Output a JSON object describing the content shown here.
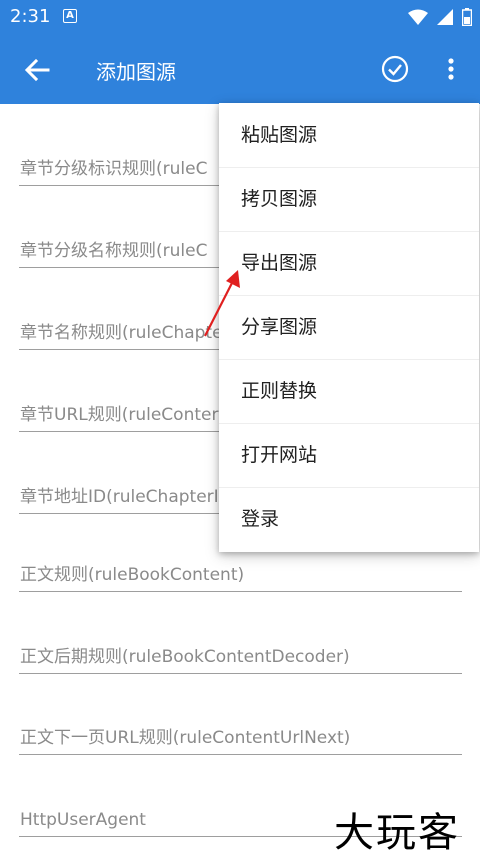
{
  "status_bar": {
    "time": "2:31",
    "notification_letter": "A",
    "icons": [
      "wifi-icon",
      "signal-icon",
      "battery-icon"
    ]
  },
  "app_bar": {
    "title": "添加图源",
    "back_icon": "arrow-left-icon",
    "check_icon": "check-circle-icon",
    "more_icon": "more-vert-icon",
    "color": "#2f82dc"
  },
  "fields": [
    {
      "label": "章节分级标识规则(ruleC"
    },
    {
      "label": "章节分级名称规则(ruleC"
    },
    {
      "label": "章节名称规则(ruleChapte"
    },
    {
      "label": "章节URL规则(ruleConter"
    },
    {
      "label": "章节地址ID(ruleChapterI"
    },
    {
      "label": "正文规则(ruleBookContent)"
    },
    {
      "label": "正文后期规则(ruleBookContentDecoder)"
    },
    {
      "label": "正文下一页URL规则(ruleContentUrlNext)"
    },
    {
      "label": "HttpUserAgent"
    }
  ],
  "menu": {
    "items": [
      {
        "label": "粘贴图源"
      },
      {
        "label": "拷贝图源"
      },
      {
        "label": "导出图源"
      },
      {
        "label": "分享图源"
      },
      {
        "label": "正则替换"
      },
      {
        "label": "打开网站"
      },
      {
        "label": "登录"
      }
    ]
  },
  "watermark": "大玩客",
  "annotation_color": "#e02020"
}
